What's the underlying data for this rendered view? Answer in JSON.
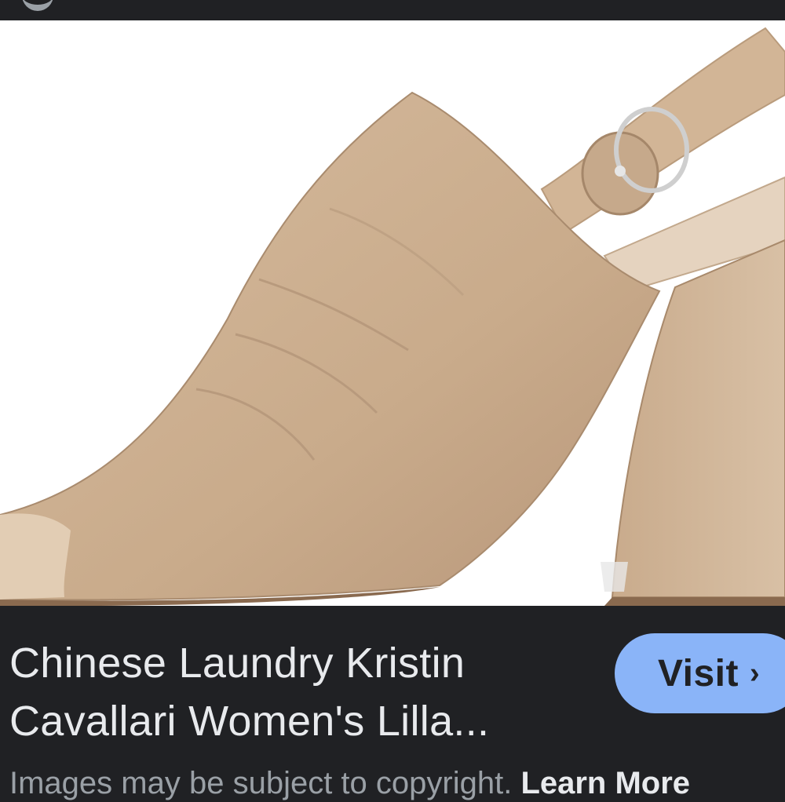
{
  "product": {
    "title_line1": "Chinese Laundry Kristin",
    "title_line2": "Cavallari Women's Lilla..."
  },
  "visit_button": {
    "label": "Visit",
    "icon": "chevron-right-icon",
    "glyph": "›",
    "color": "#8ab4f8"
  },
  "footer": {
    "copyright_text": "Images may be subject to copyright.",
    "learn_more_label": "Learn More"
  },
  "colors": {
    "background": "#202124",
    "text_primary": "#e8eaed",
    "text_secondary": "#9aa0a6"
  }
}
